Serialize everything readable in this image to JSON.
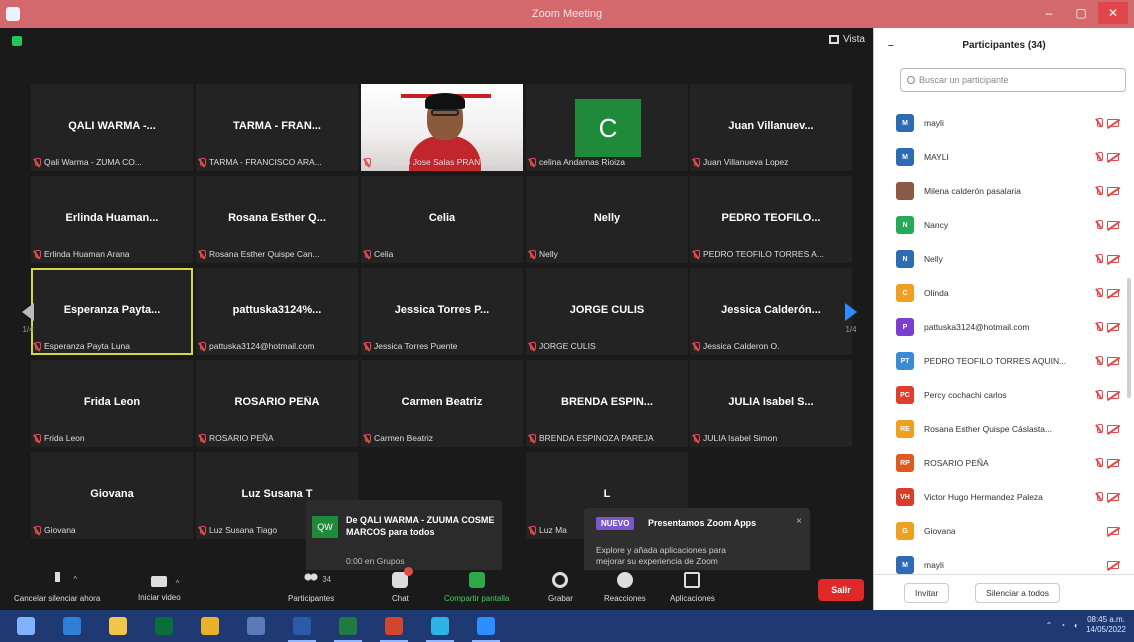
{
  "window": {
    "title": "Zoom Meeting",
    "buttons": [
      "–",
      "▢",
      "✕"
    ]
  },
  "meeting": {
    "view_label": "Vista",
    "page_left": "1/4",
    "page_right": "1/4",
    "tiles": [
      {
        "name": "QALI WARMA -...",
        "label": "Qali Warma - ZUMA CO..."
      },
      {
        "name": "TARMA - FRAN...",
        "label": "TARMA - FRANCISCO ARA..."
      },
      {
        "name": "",
        "label": "Fernando Jose Salas PRANO ZAIN...",
        "video": true
      },
      {
        "name": "C",
        "label": "celina Andamas Rioiza",
        "avatar": true
      },
      {
        "name": "Juan Villanuev...",
        "label": "Juan Villanueva Lopez"
      },
      {
        "name": "Erlinda Huaman...",
        "label": "Erlinda Huaman Arana"
      },
      {
        "name": "Rosana Esther Q...",
        "label": "Rosana Esther Quispe Can..."
      },
      {
        "name": "Celia",
        "label": "Celia"
      },
      {
        "name": "Nelly",
        "label": "Nelly"
      },
      {
        "name": "PEDRO TEOFILO...",
        "label": "PEDRO TEOFILO TORRES A..."
      },
      {
        "name": "Esperanza Payta...",
        "label": "Esperanza Payta Luna",
        "active": true
      },
      {
        "name": "pattuska3124%...",
        "label": "pattuska3124@hotmail.com"
      },
      {
        "name": "Jessica Torres P...",
        "label": "Jessica Torres Puente"
      },
      {
        "name": "JORGE CULIS",
        "label": "JORGE CULIS"
      },
      {
        "name": "Jessica Calderón...",
        "label": "Jessica Calderon O."
      },
      {
        "name": "Frida Leon",
        "label": "Frida Leon"
      },
      {
        "name": "ROSARIO PEÑA",
        "label": "ROSARIO PEÑA"
      },
      {
        "name": "Carmen Beatriz",
        "label": "Carmen Beatriz"
      },
      {
        "name": "BRENDA ESPIN...",
        "label": "BRENDA ESPINOZA PAREJA"
      },
      {
        "name": "JULIA Isabel S...",
        "label": "JULIA Isabel Simon"
      },
      {
        "name": "Giovana",
        "label": "Giovana"
      },
      {
        "name": "Luz Susana T",
        "label": "Luz Susana Tiago"
      },
      {
        "name": "",
        "label": ""
      },
      {
        "name": "L",
        "label": "Luz Ma"
      },
      {
        "name": "",
        "label": ""
      }
    ],
    "chat_popup": {
      "avatar": "QW",
      "message": "De QALI WARMA - ZUUMA COSME MARCOS para todos",
      "sub": "0:00 en Grupos"
    },
    "apps_popup": {
      "badge": "NUEVO",
      "title": "Presentamos Zoom Apps",
      "close": "×",
      "body": "Explore y añada aplicaciones para mejorar su experiencia de Zoom"
    }
  },
  "toolbar": {
    "items": [
      {
        "label": "Cancelar silenciar ahora",
        "icon": "microphone-icon"
      },
      {
        "label": "Iniciar video",
        "icon": "camera-icon"
      },
      {
        "label": "Participantes",
        "icon": "participants-icon",
        "count": "34"
      },
      {
        "label": "Chat",
        "icon": "chat-icon"
      },
      {
        "label": "Compartir pantalla",
        "icon": "share-screen-icon"
      },
      {
        "label": "Grabar",
        "icon": "record-icon"
      },
      {
        "label": "Reacciones",
        "icon": "reactions-icon"
      },
      {
        "label": "Aplicaciones",
        "icon": "apps-icon"
      }
    ],
    "leave": "Salir"
  },
  "panel": {
    "title": "Participantes (34)",
    "dash": "–",
    "search_placeholder": "Buscar un participante",
    "participants": [
      {
        "initials": "M",
        "name": "mayli",
        "color": "#2d6bb5"
      },
      {
        "initials": "M",
        "name": "MAYLI",
        "color": "#2d6bb5"
      },
      {
        "initials": "",
        "name": "Milena calderón pasalaria",
        "color": "#8a5a44"
      },
      {
        "initials": "N",
        "name": "Nancy",
        "color": "#27a85a"
      },
      {
        "initials": "N",
        "name": "Nelly",
        "color": "#2d6bb5"
      },
      {
        "initials": "C",
        "name": "Olinda",
        "color": "#f0a020"
      },
      {
        "initials": "P",
        "name": "pattuska3124@hotmail.com",
        "color": "#7b3fcf"
      },
      {
        "initials": "PT",
        "name": "PEDRO TEOFILO TORRES AQUIN...",
        "color": "#3a8bd6"
      },
      {
        "initials": "PC",
        "name": "Percy cochachi carlos",
        "color": "#e03d2e"
      },
      {
        "initials": "RE",
        "name": "Rosana Esther Quispe Cáslasta...",
        "color": "#f0a020"
      },
      {
        "initials": "RP",
        "name": "ROSARIO PEÑA",
        "color": "#e05a1e"
      },
      {
        "initials": "VH",
        "name": "Victor Hugo Hermandez Paleza",
        "color": "#d93c2b"
      },
      {
        "initials": "G",
        "name": "Giovana",
        "color": "#f0a020"
      },
      {
        "initials": "M",
        "name": "mayli",
        "color": "#2d6bb5"
      }
    ],
    "footer": [
      "Invitar",
      "Silenciar a todos"
    ]
  },
  "taskbar": {
    "apps": [
      {
        "icon": "windows-start-icon",
        "color": "#7fb2ff"
      },
      {
        "icon": "edge-icon",
        "color": "#2f7fd6"
      },
      {
        "icon": "file-explorer-icon",
        "color": "#f3c54a"
      },
      {
        "icon": "store-icon",
        "color": "#0a6e3a"
      },
      {
        "icon": "chrome-icon",
        "color": "#e8b32a"
      },
      {
        "icon": "photos-icon",
        "color": "#5a7ab8"
      },
      {
        "icon": "word-icon",
        "color": "#2b5aa8"
      },
      {
        "icon": "excel-icon",
        "color": "#1f7a44"
      },
      {
        "icon": "powerpoint-icon",
        "color": "#d1462d"
      },
      {
        "icon": "edge-browser-icon",
        "color": "#2db3e6"
      },
      {
        "icon": "zoom-icon",
        "color": "#2d8cff"
      }
    ],
    "time": "08:45 a.m.",
    "date": "14/05/2022"
  }
}
